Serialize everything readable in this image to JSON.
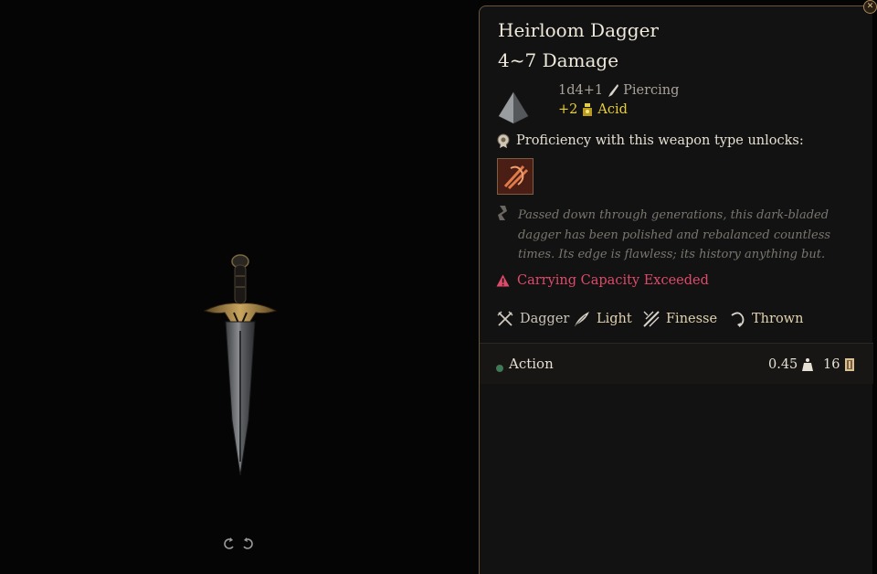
{
  "item": {
    "name": "Heirloom Dagger",
    "damage_range": "4~7 Damage",
    "damage": {
      "dice": "1d4+1",
      "type": "Piercing",
      "bonus_value": "+2",
      "bonus_type": "Acid"
    },
    "proficiency_text": "Proficiency with this weapon type unlocks:",
    "description": "Passed down through generations, this dark-bladed dagger has been polished and rebalanced countless times. Its edge is flawless; its history anything but.",
    "warning": "Carrying Capacity Exceeded",
    "properties": [
      {
        "label": "Dagger",
        "icon": "dagger-icon"
      },
      {
        "label": "Light",
        "icon": "feather-icon"
      },
      {
        "label": "Finesse",
        "icon": "finesse-icon"
      },
      {
        "label": "Thrown",
        "icon": "thrown-icon"
      }
    ],
    "action_label": "Action",
    "weight": "0.45",
    "price": "16"
  },
  "colors": {
    "accent_gold": "#e8cf3a",
    "warning": "#e04a6a",
    "panel_border": "#6b5642",
    "action_dot": "#3d7a55"
  },
  "icons": {
    "close": "close-icon",
    "rotate_left": "rotate-left-icon",
    "rotate_right": "rotate-right-icon"
  }
}
